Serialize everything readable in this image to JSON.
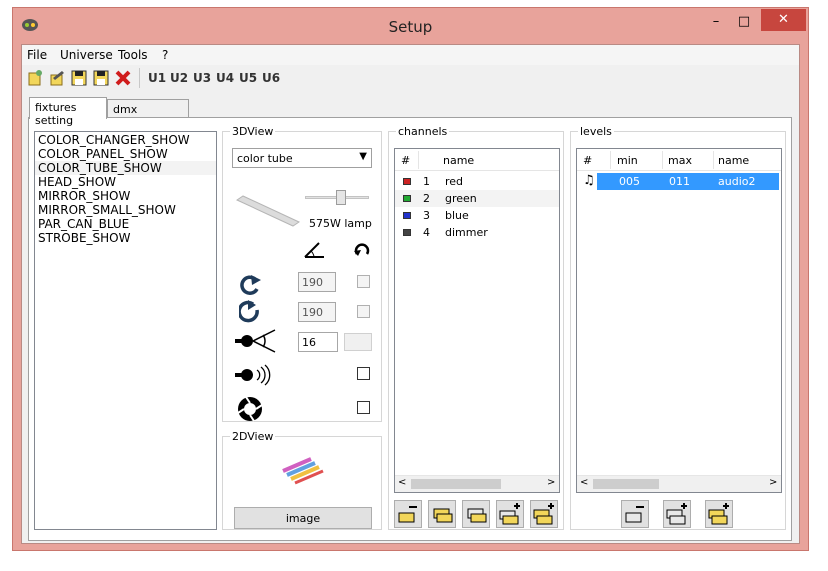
{
  "window": {
    "title": "Setup",
    "controls": [
      "–",
      "□",
      "✕"
    ]
  },
  "menu": [
    "File",
    "Universe",
    "Tools",
    "?"
  ],
  "toolbar": {
    "universes": [
      "U1",
      "U2",
      "U3",
      "U4",
      "U5",
      "U6"
    ]
  },
  "tabs": [
    "fixtures setting",
    "dmx addressing"
  ],
  "fixtures": [
    "COLOR_CHANGER_SHOW",
    "COLOR_PANEL_SHOW",
    "COLOR_TUBE_SHOW",
    "HEAD_SHOW",
    "MIRROR_SHOW",
    "MIRROR_SMALL_SHOW",
    "PAR_CAN_BLUE",
    "STROBE_SHOW"
  ],
  "view3d": {
    "title": "3DView",
    "fixture_type": "color tube",
    "slider_fraction": 0.55,
    "lamp_label": "575W lamp",
    "rotation_x": "190",
    "rotation_y": "190",
    "beam_angle": "16"
  },
  "view2d": {
    "title": "2DView",
    "image_button": "image"
  },
  "channels": {
    "title": "channels",
    "headers": [
      "#",
      "name"
    ],
    "rows": [
      {
        "n": "1",
        "name": "red",
        "color": "#cc2222"
      },
      {
        "n": "2",
        "name": "green",
        "color": "#22aa33"
      },
      {
        "n": "3",
        "name": "blue",
        "color": "#2233cc"
      },
      {
        "n": "4",
        "name": "dimmer",
        "color": "#444444"
      }
    ]
  },
  "levels": {
    "title": "levels",
    "headers": [
      "#",
      "min",
      "max",
      "name"
    ],
    "rows": [
      {
        "min": "005",
        "max": "011",
        "name": "audio2"
      }
    ]
  },
  "colors": {
    "accent": "#3399ff",
    "titlebar": "#e8a39b",
    "close": "#c7463e"
  }
}
